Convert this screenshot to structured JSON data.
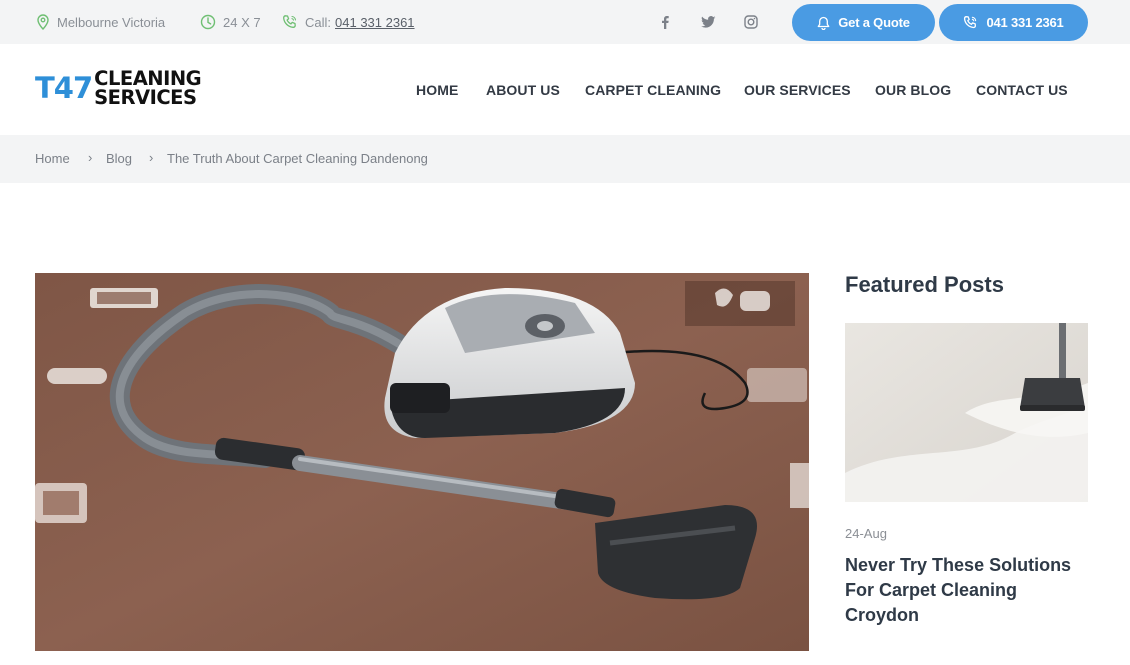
{
  "topbar": {
    "location": "Melbourne Victoria",
    "hours": "24 X 7",
    "call_label": "Call:",
    "call_number": "041 331 2361",
    "social": [
      "facebook-icon",
      "twitter-icon",
      "instagram-icon"
    ],
    "quote_button": "Get a Quote",
    "phone_button": "041 331 2361"
  },
  "header": {
    "logo_number": "T47",
    "logo_line1": "CLEANING",
    "logo_line2": "SERVICES",
    "nav": [
      "HOME",
      "ABOUT US",
      "CARPET CLEANING",
      "OUR SERVICES",
      "OUR BLOG",
      "CONTACT US"
    ]
  },
  "breadcrumb": {
    "items": [
      "Home",
      "Blog",
      "The Truth About Carpet Cleaning Dandenong"
    ],
    "separator": "›"
  },
  "sidebar": {
    "title": "Featured Posts",
    "post": {
      "date": "24-Aug",
      "title": "Never Try These Solutions For Carpet Cleaning Croydon"
    }
  },
  "colors": {
    "accent": "#4a9be3",
    "logo_blue": "#2e8fd8",
    "topbar_bg": "#f3f4f5",
    "text_dark": "#2f3a47",
    "icon_green": "#6fbf73"
  }
}
